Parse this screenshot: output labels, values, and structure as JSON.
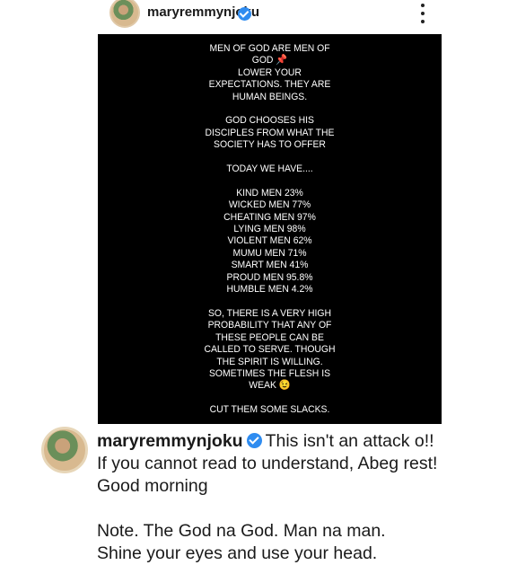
{
  "header": {
    "username": "maryremmynjoku"
  },
  "post_image": {
    "lines": [
      "MEN OF GOD ARE MEN OF",
      "GOD 📌",
      "LOWER YOUR",
      "EXPECTATIONS. THEY ARE",
      "HUMAN BEINGS.",
      "",
      "GOD CHOOSES HIS",
      "DISCIPLES FROM WHAT THE",
      "SOCIETY HAS TO OFFER",
      "",
      "TODAY WE HAVE....",
      "",
      "KIND MEN 23%",
      "WICKED MEN 77%",
      "CHEATING MEN 97%",
      "LYING MEN 98%",
      "VIOLENT MEN 62%",
      "MUMU MEN 71%",
      "SMART MEN 41%",
      "PROUD MEN 95.8%",
      "HUMBLE MEN 4.2%",
      "",
      "SO, THERE IS A VERY HIGH",
      "PROBABILITY THAT ANY OF",
      "THESE PEOPLE CAN BE",
      "CALLED TO SERVE.  THOUGH",
      "THE SPIRIT IS WILLING.",
      "SOMETIMES THE FLESH IS",
      "WEAK 😉",
      "",
      "CUT THEM SOME SLACKS."
    ]
  },
  "comment": {
    "username": "maryremmynjoku",
    "first_line_text": "This isn't an attack o!!",
    "lines": [
      "If you cannot read to understand, Abeg rest!",
      "Good morning",
      "",
      "Note. The God na God. Man na man.",
      "Shine your eyes and use your head."
    ]
  },
  "colors": {
    "verified": "#2f8cf0",
    "image_background": "#000000",
    "image_text": "#ffffff"
  },
  "icons": [
    "verified-badge-icon",
    "more-options-icon"
  ]
}
